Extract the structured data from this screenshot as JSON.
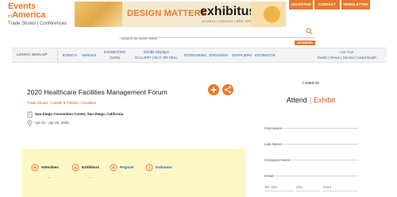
{
  "logo": {
    "line1": "Events",
    "line2_prefix": "in",
    "line2_main": "America",
    "tagline": "Trade Shows | Conferences"
  },
  "banner": {
    "design_matters": "DESIGN MATTERS",
    "brand": "exhibitus",
    "locations": "ATLANTA • CHICAGO • NEW YORK"
  },
  "top_buttons": [
    "ADVERTISE",
    "CONTACT LIST",
    "NEWSLETTER"
  ],
  "search": {
    "placeholder": "Search by event name",
    "advanced_label": "ADVANCED"
  },
  "nav": {
    "login": "LOGIN | SIGN UP",
    "events": "EVENTS",
    "venues": "VENUES",
    "exhibitors": "EXHIBITORS",
    "exhibitors_count": "(6406)",
    "displays_line1": "Exhibit Displays",
    "displays_line2": "GALLERY | BUY OR SELL",
    "interviews": "INTERVIEWS",
    "speakers": "SPEAKERS",
    "suppliers": "SUPPLIERS",
    "estimator": "ESTIMATOR",
    "list_line1": "List Your",
    "list_line2": "Event | Venue | Service | Used Booth"
  },
  "event": {
    "title": "2020 Healthcare Facilities Management Forum",
    "breadcrumb": "Trade Shows » Health & Fitness » Facilities",
    "venue": "San Diego Convention Center, San Diego, California",
    "dates": "Apr 21 - Apr 22, 2020"
  },
  "stats": {
    "attendees_label": "Attendees",
    "attendees_value": "-",
    "exhibitors_label": "Exhibitors",
    "exhibitors_value": "-",
    "register_label": "Register",
    "estimator_label": "Estimator"
  },
  "form": {
    "heading": "I want to",
    "attend": "Attend",
    "separator": "|",
    "exhibit": "Exhibit",
    "first_name": "First Name",
    "last_name": "Last Name",
    "company": "Company Name",
    "email": "Email",
    "phone_1": "Tel: 333",
    "phone_2": "333",
    "phone_3": "4444"
  },
  "colors": {
    "accent": "#e8792c",
    "link": "#2a63b3",
    "stats_bg": "#fdf6c7"
  }
}
